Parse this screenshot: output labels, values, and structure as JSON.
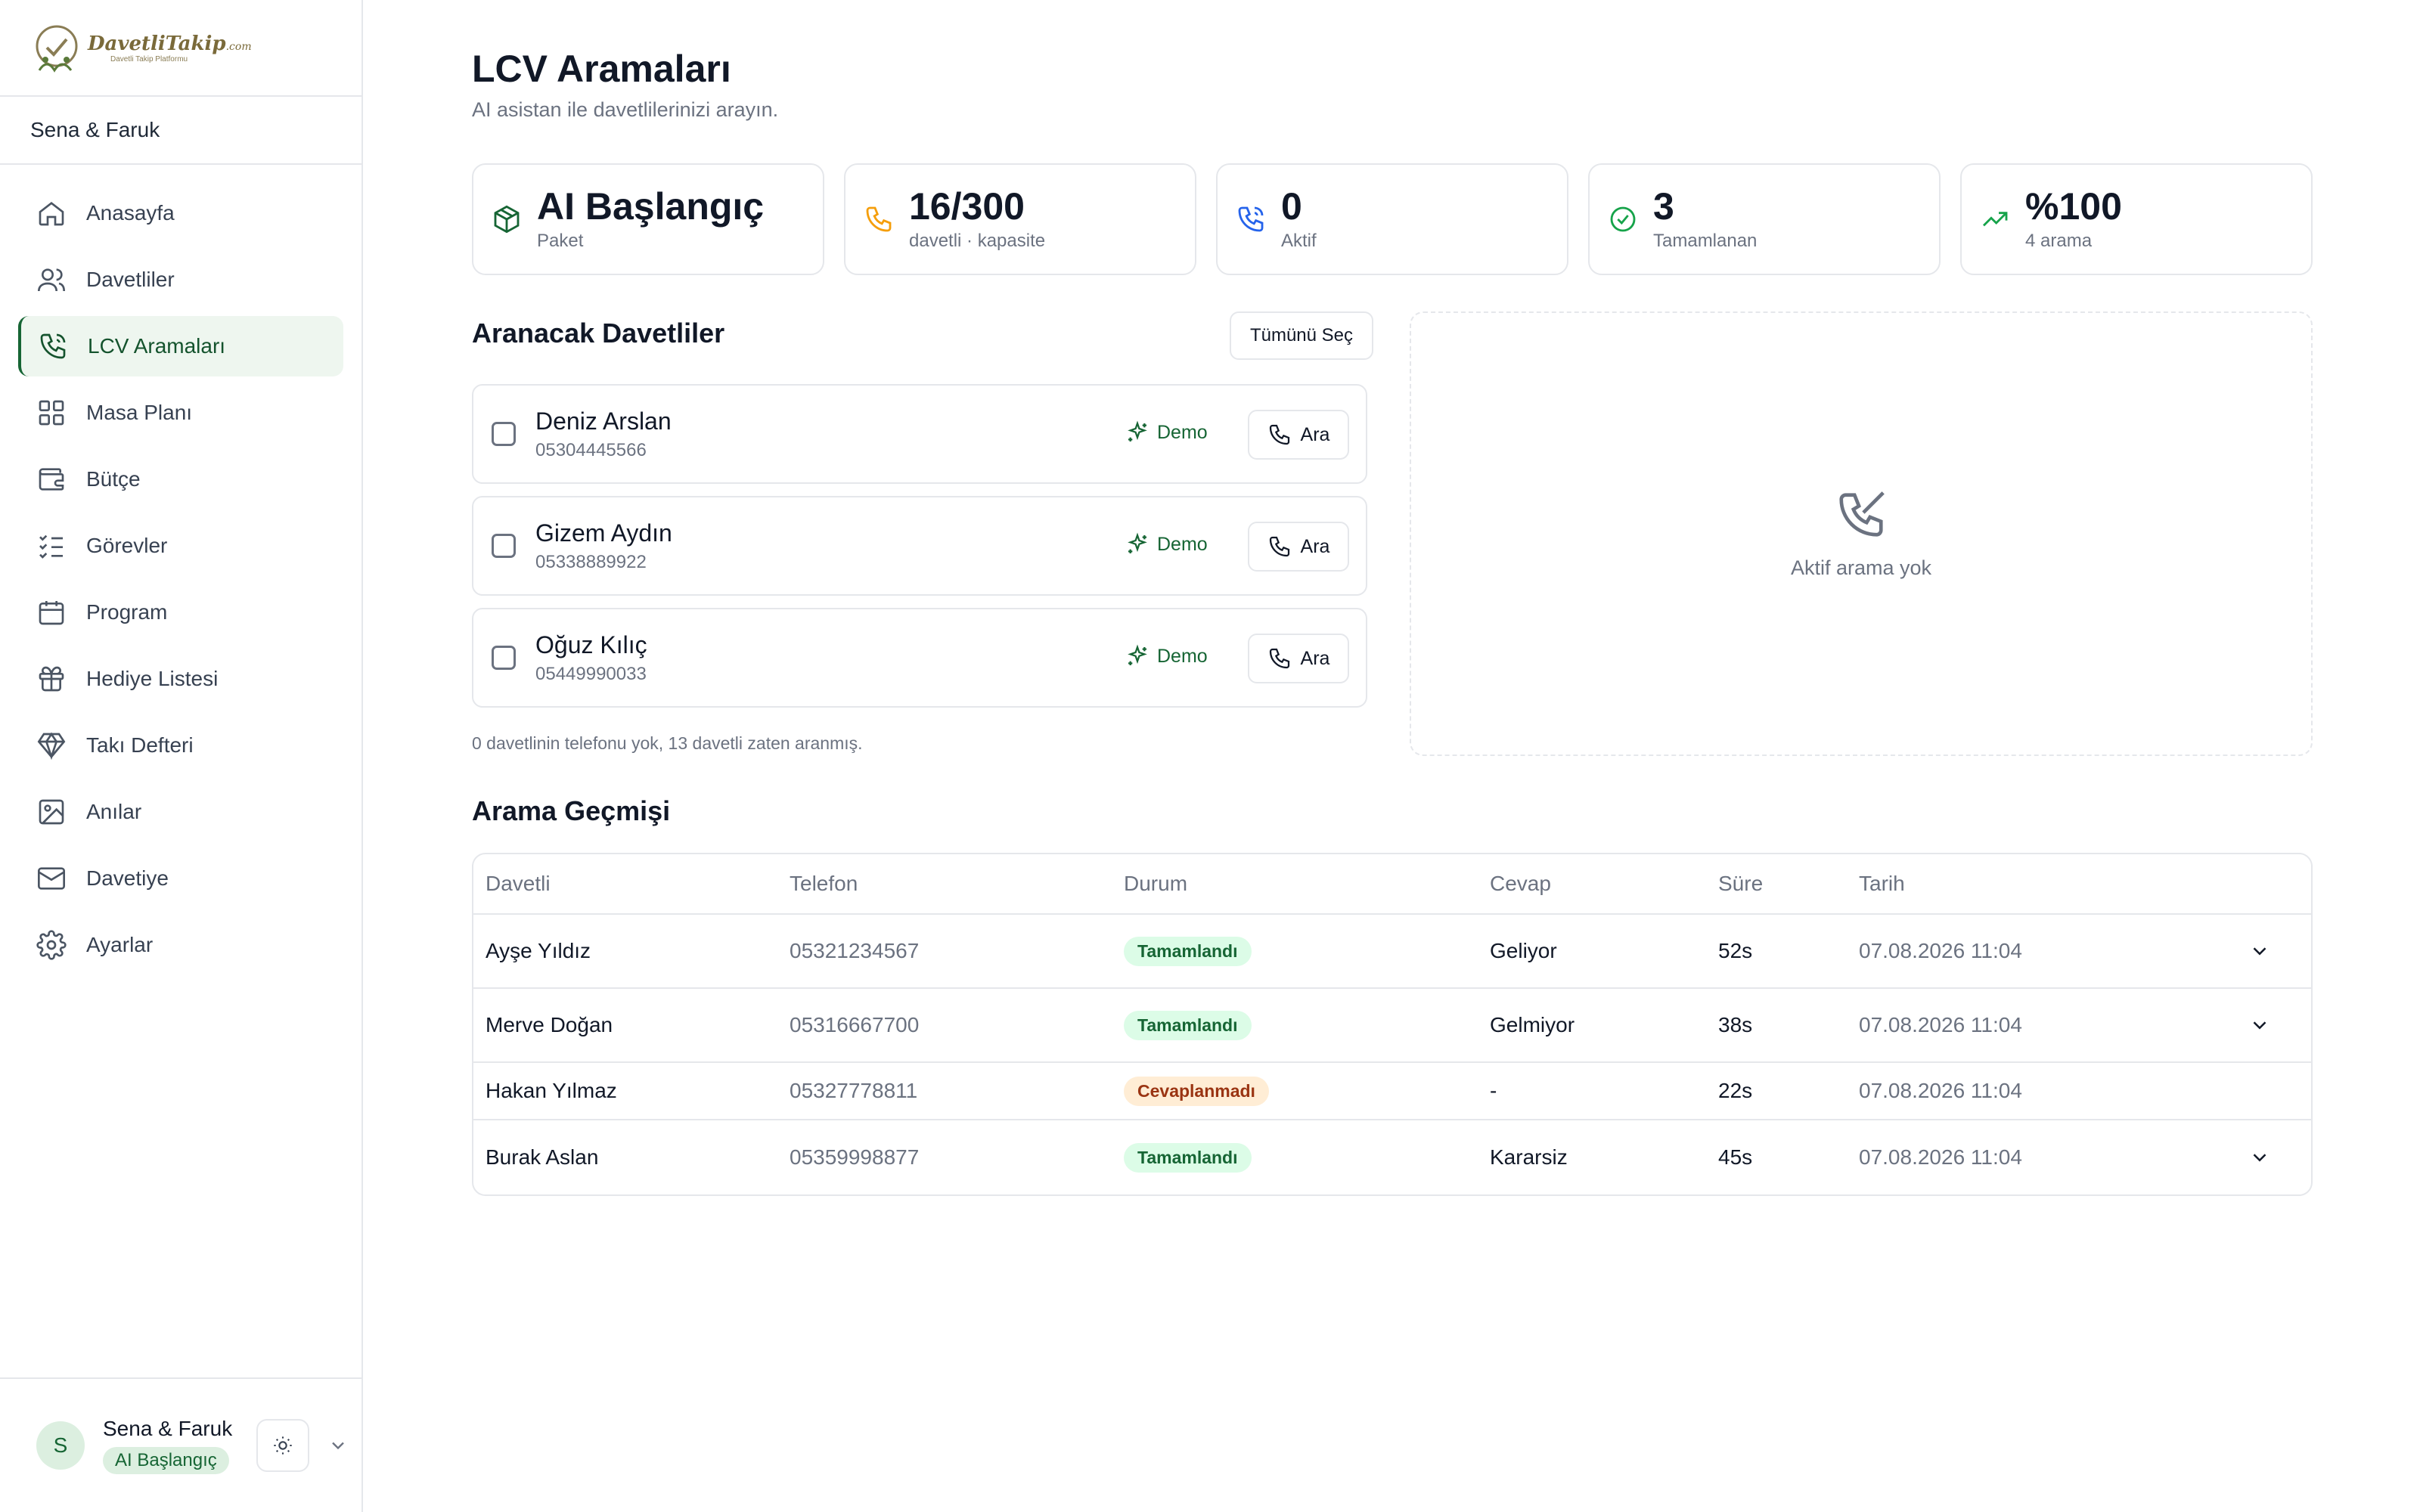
{
  "sidebar": {
    "logo": {
      "name": "DavetliTakip",
      "suffix": ".com",
      "tagline": "Davetli Takip Platformu"
    },
    "couple": "Sena & Faruk",
    "items": [
      {
        "label": "Anasayfa",
        "icon": "home-icon"
      },
      {
        "label": "Davetliler",
        "icon": "users-icon"
      },
      {
        "label": "LCV Aramaları",
        "icon": "phone-call-icon",
        "active": true
      },
      {
        "label": "Masa Planı",
        "icon": "grid-icon"
      },
      {
        "label": "Bütçe",
        "icon": "wallet-icon"
      },
      {
        "label": "Görevler",
        "icon": "list-check-icon"
      },
      {
        "label": "Program",
        "icon": "calendar-icon"
      },
      {
        "label": "Hediye Listesi",
        "icon": "gift-icon"
      },
      {
        "label": "Takı Defteri",
        "icon": "diamond-icon"
      },
      {
        "label": "Anılar",
        "icon": "image-icon"
      },
      {
        "label": "Davetiye",
        "icon": "mail-icon"
      },
      {
        "label": "Ayarlar",
        "icon": "gear-icon"
      }
    ],
    "footer": {
      "avatar": "S",
      "name": "Sena & Faruk",
      "plan": "AI Başlangıç"
    }
  },
  "main": {
    "title": "LCV Aramaları",
    "subtitle": "AI asistan ile davetlilerinizi arayın.",
    "stats": [
      {
        "value": "AI Başlangıç",
        "label": "Paket",
        "icon": "package-icon",
        "color": "#166534"
      },
      {
        "value": "16/300",
        "label": "davetli · kapasite",
        "icon": "phone-icon",
        "color": "#f59e0b"
      },
      {
        "value": "0",
        "label": "Aktif",
        "icon": "phone-call-icon",
        "color": "#2563eb"
      },
      {
        "value": "3",
        "label": "Tamamlanan",
        "icon": "check-circle-icon",
        "color": "#16a34a"
      },
      {
        "value": "%100",
        "label": "4 arama",
        "icon": "trending-up-icon",
        "color": "#16a34a"
      }
    ],
    "guests_section": {
      "title": "Aranacak Davetliler",
      "select_all": "Tümünü Seç",
      "demo_label": "Demo",
      "call_label": "Ara",
      "guests": [
        {
          "name": "Deniz Arslan",
          "phone": "05304445566"
        },
        {
          "name": "Gizem Aydın",
          "phone": "05338889922"
        },
        {
          "name": "Oğuz Kılıç",
          "phone": "05449990033"
        }
      ],
      "note": "0 davetlinin telefonu yok, 13 davetli zaten aranmış."
    },
    "active_calls": {
      "empty_text": "Aktif arama yok"
    },
    "history": {
      "title": "Arama Geçmişi",
      "columns": [
        "Davetli",
        "Telefon",
        "Durum",
        "Cevap",
        "Süre",
        "Tarih"
      ],
      "rows": [
        {
          "guest": "Ayşe Yıldız",
          "phone": "05321234567",
          "status": "Tamamlandı",
          "status_type": "ok",
          "answer": "Geliyor",
          "duration": "52s",
          "date": "07.08.2026 11:04",
          "expandable": true
        },
        {
          "guest": "Merve Doğan",
          "phone": "05316667700",
          "status": "Tamamlandı",
          "status_type": "ok",
          "answer": "Gelmiyor",
          "duration": "38s",
          "date": "07.08.2026 11:04",
          "expandable": true
        },
        {
          "guest": "Hakan Yılmaz",
          "phone": "05327778811",
          "status": "Cevaplanmadı",
          "status_type": "warn",
          "answer": "-",
          "duration": "22s",
          "date": "07.08.2026 11:04",
          "expandable": false
        },
        {
          "guest": "Burak Aslan",
          "phone": "05359998877",
          "status": "Tamamlandı",
          "status_type": "ok",
          "answer": "Kararsiz",
          "duration": "45s",
          "date": "07.08.2026 11:04",
          "expandable": true
        }
      ]
    }
  }
}
